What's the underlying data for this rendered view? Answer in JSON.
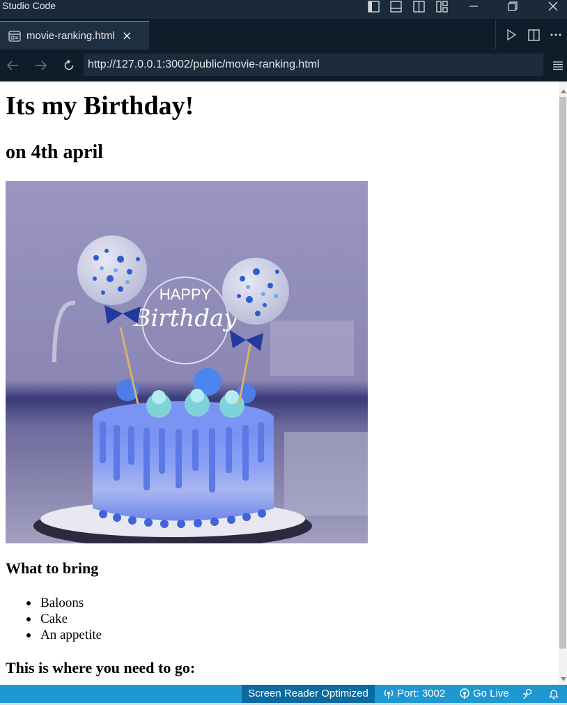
{
  "window": {
    "title": "l Studio Code"
  },
  "tab": {
    "label": "movie-ranking.html",
    "close_glyph": "×"
  },
  "browser": {
    "url": "http://127.0.0.1:3002/public/movie-ranking.html"
  },
  "page": {
    "heading": "Its my Birthday!",
    "subheading": "on 4th april",
    "image_text": [
      "HAPPY",
      "Birthday"
    ],
    "bring_heading": "What to bring",
    "bring_items": [
      "Baloons",
      "Cake",
      "An appetite"
    ],
    "go_heading": "This is where you need to go:"
  },
  "statusbar": {
    "screen_reader": "Screen Reader Optimized",
    "port": "Port: 3002",
    "go_live": "Go Live"
  },
  "colors": {
    "accent": "#1f98d2",
    "screen_reader_bg": "#0b6aa0",
    "chrome_bg": "#0f1d2b"
  }
}
